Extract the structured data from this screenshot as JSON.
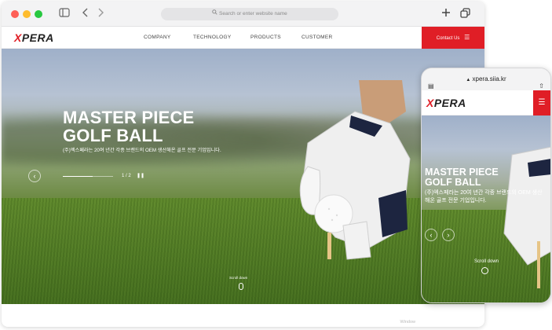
{
  "browser": {
    "url_placeholder": "Search or enter website name"
  },
  "site": {
    "logo_x": "X",
    "logo_rest": "PERA",
    "nav": [
      "COMPANY",
      "TECHNOLOGY",
      "PRODUCTS",
      "CUSTOMER"
    ],
    "contact_label": "Contact Us"
  },
  "hero": {
    "title_line1": "MASTER PIECE",
    "title_line2": "GOLF BALL",
    "subtitle": "(주)엑스페라는 20여 년간 각종 브랜드의 OEM 생산해온 골프 전문 기업입니다.",
    "pager": "1 / 2",
    "progress": 0.6,
    "scroll_label": "Scroll down"
  },
  "phone": {
    "url": "xpera.siia.kr",
    "title_line1": "MASTER PIECE",
    "title_line2": "GOLF BALL",
    "subtitle": "(주)엑스페라는 20여 년간 각종 브랜드의 OEM 생산해온 골프 전문 기업입니다.",
    "scroll_label": "Scroll down"
  },
  "watermark": "Window",
  "colors": {
    "brand_red": "#e01e26"
  },
  "icons": {
    "sidebar": "sidebar-icon",
    "back": "chevron-left-icon",
    "forward": "chevron-right-icon",
    "search": "search-icon",
    "new_tab": "plus-icon",
    "tabs": "tabs-icon",
    "menu": "hamburger-icon"
  }
}
